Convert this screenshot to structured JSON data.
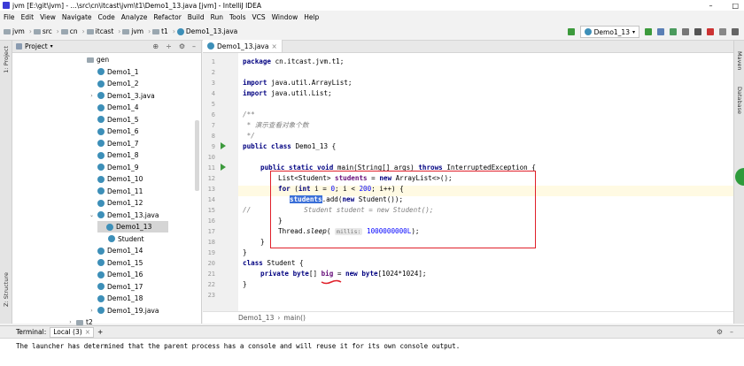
{
  "window": {
    "title": "jvm [E:\\git\\jvm] - ...\\src\\cn\\itcast\\jvm\\t1\\Demo1_13.java [jvm] - IntelliJ IDEA",
    "controls": [
      "–",
      "□"
    ]
  },
  "menu": [
    "File",
    "Edit",
    "View",
    "Navigate",
    "Code",
    "Analyze",
    "Refactor",
    "Build",
    "Run",
    "Tools",
    "VCS",
    "Window",
    "Help"
  ],
  "breadcrumbs": [
    "jvm",
    "src",
    "cn",
    "itcast",
    "jvm",
    "t1",
    "Demo1_13.java"
  ],
  "toolbar": {
    "run_config": "Demo1_13"
  },
  "side_tabs": {
    "project": "1: Project",
    "structure": "Z: Structure",
    "maven": "Maven",
    "database": "Database"
  },
  "project_panel": {
    "title": "Project",
    "items": [
      {
        "label": "gen",
        "kind": "folder",
        "arrow": ""
      },
      {
        "label": "Demo1_1",
        "kind": "class",
        "arrow": ""
      },
      {
        "label": "Demo1_2",
        "kind": "class",
        "arrow": ""
      },
      {
        "label": "Demo1_3.java",
        "kind": "class",
        "arrow": "›"
      },
      {
        "label": "Demo1_4",
        "kind": "class",
        "arrow": ""
      },
      {
        "label": "Demo1_5",
        "kind": "class",
        "arrow": ""
      },
      {
        "label": "Demo1_6",
        "kind": "class",
        "arrow": ""
      },
      {
        "label": "Demo1_7",
        "kind": "class",
        "arrow": ""
      },
      {
        "label": "Demo1_8",
        "kind": "class",
        "arrow": ""
      },
      {
        "label": "Demo1_9",
        "kind": "class",
        "arrow": ""
      },
      {
        "label": "Demo1_10",
        "kind": "class",
        "arrow": ""
      },
      {
        "label": "Demo1_11",
        "kind": "class",
        "arrow": ""
      },
      {
        "label": "Demo1_12",
        "kind": "class",
        "arrow": ""
      },
      {
        "label": "Demo1_13.java",
        "kind": "class",
        "arrow": "⌄"
      },
      {
        "label": "Demo1_13",
        "kind": "class",
        "arrow": "",
        "selected": true
      },
      {
        "label": "Student",
        "kind": "class",
        "arrow": ""
      },
      {
        "label": "Demo1_14",
        "kind": "class",
        "arrow": ""
      },
      {
        "label": "Demo1_15",
        "kind": "class",
        "arrow": ""
      },
      {
        "label": "Demo1_16",
        "kind": "class",
        "arrow": ""
      },
      {
        "label": "Demo1_17",
        "kind": "class",
        "arrow": ""
      },
      {
        "label": "Demo1_18",
        "kind": "class",
        "arrow": ""
      },
      {
        "label": "Demo1_19.java",
        "kind": "class",
        "arrow": "›"
      },
      {
        "label": "t2",
        "kind": "folder",
        "arrow": "›"
      }
    ]
  },
  "editor": {
    "tab": "Demo1_13.java",
    "line_numbers": [
      "1",
      "2",
      "3",
      "4",
      "5",
      "6",
      "7",
      "8",
      "9",
      "10",
      "11",
      "12",
      "13",
      "14",
      "15",
      "16",
      "17",
      "18",
      "19",
      "20",
      "21",
      "22",
      "23"
    ],
    "code": {
      "l1": {
        "kw": "package",
        "rest": " cn.itcast.jvm.t1;"
      },
      "l3": {
        "kw": "import",
        "rest": " java.util.ArrayList;"
      },
      "l4": {
        "kw": "import",
        "rest": " java.util.List;"
      },
      "l6": "/**",
      "l7": " * 演示查看对象个数",
      "l8": " */",
      "l9": {
        "kw": "public class",
        "rest": " Demo1_13 {"
      },
      "l11": {
        "kw": "public static void",
        "rest": " main(String[] args) ",
        "kw2": "throws",
        "rest2": " InterruptedException {"
      },
      "l12": {
        "pre": "List<Student> ",
        "fld": "students",
        "mid": " = ",
        "kw": "new",
        "rest": " ArrayList<>();"
      },
      "l13": {
        "kw": "for",
        "p1": " (",
        "kw2": "int",
        "p2": " i = ",
        "n1": "0",
        "p3": "; i < ",
        "n2": "200",
        "p4": "; i++) {"
      },
      "l14": {
        "sel": "students",
        "rest": ".add(",
        "kw": "new",
        "rest2": " Student());"
      },
      "l15": {
        "prefix": "//",
        "comment": "Student student = new Student();"
      },
      "l16": "}",
      "l17": {
        "pre": "Thread.",
        "method": "sleep",
        "p": "( ",
        "hint": "millis:",
        "num": "1000000000L",
        "end": ");"
      },
      "l18": "}",
      "l19": "}",
      "l20": {
        "kw": "class",
        "rest": " Student {"
      },
      "l21": {
        "kw": "private byte",
        "p": "[] ",
        "fld": "big",
        "mid": " = ",
        "kw2": "new byte",
        "rest": "[1024*1024];"
      },
      "l22": "}"
    },
    "breadcrumb": [
      "Demo1_13",
      "main()"
    ],
    "colors": {
      "highlight_box": "#e0202a",
      "selection": "#3a6fd8"
    }
  },
  "terminal": {
    "label": "Terminal:",
    "tab": "Local (3)",
    "add": "+",
    "output": "The launcher has determined that the parent process has a console and will reuse it for its own console output."
  }
}
